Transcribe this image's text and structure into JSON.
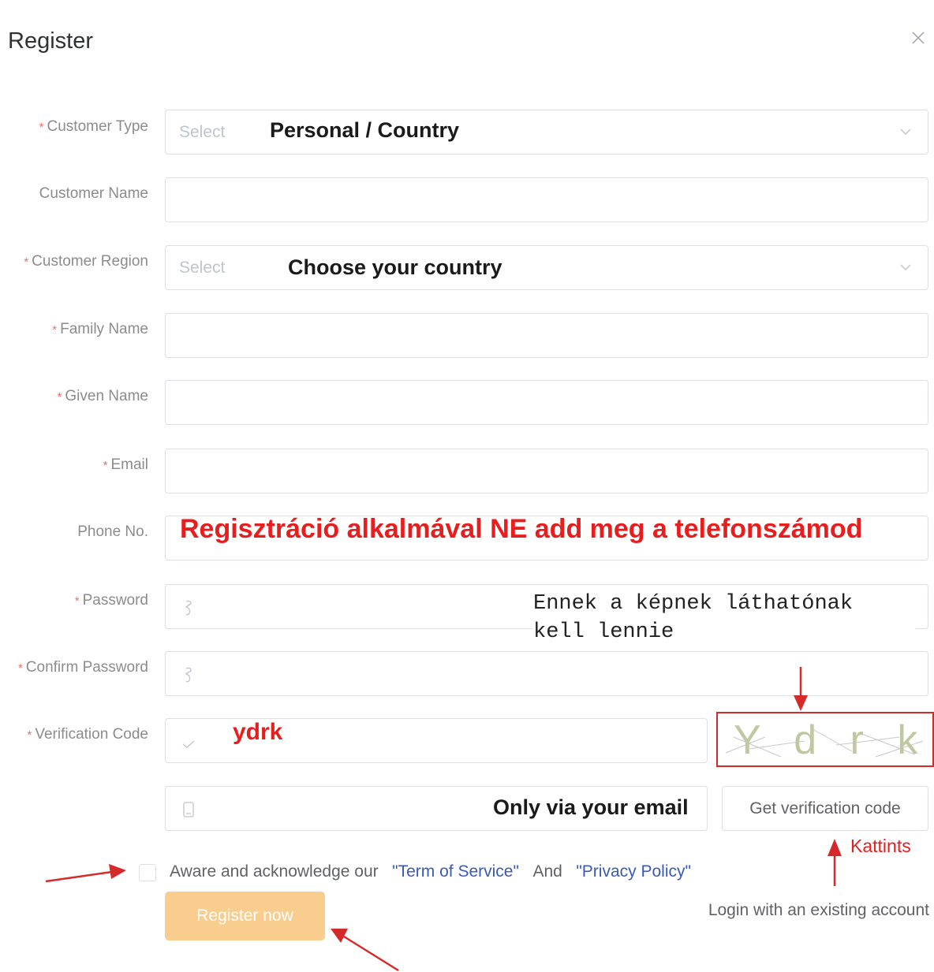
{
  "dialog": {
    "title": "Register"
  },
  "form": {
    "customer_type": {
      "label": "Customer Type",
      "placeholder": "Select"
    },
    "customer_name": {
      "label": "Customer Name"
    },
    "customer_region": {
      "label": "Customer Region",
      "placeholder": "Select"
    },
    "family_name": {
      "label": "Family Name"
    },
    "given_name": {
      "label": "Given Name"
    },
    "email": {
      "label": "Email"
    },
    "phone": {
      "label": "Phone No."
    },
    "password": {
      "label": "Password"
    },
    "confirm_password": {
      "label": "Confirm Password"
    },
    "verification_code": {
      "label": "Verification Code",
      "captcha_text": "Y d r k"
    },
    "email_code": {
      "button": "Get verification code"
    },
    "required_mark": "*"
  },
  "agreement": {
    "prefix": "Aware and acknowledge our",
    "terms": "\"Term of Service\"",
    "and": "And",
    "privacy": "\"Privacy Policy\""
  },
  "actions": {
    "register": "Register now",
    "login": "Login with an existing account"
  },
  "annotations": {
    "customer_type": "Personal / Country",
    "customer_region": "Choose your country",
    "phone_warning": "Regisztráció alkalmával NE add meg a telefonszámod",
    "captcha_note": "Ennek a képnek láthatónak kell lennie",
    "code_value": "ydrk",
    "email_note": "Only via your email",
    "click_note": "Kattints"
  },
  "colors": {
    "accent_button": "#f9cd8e",
    "link": "#3a5ab5",
    "required": "#f56c6c",
    "annotation": "#e81e1e"
  }
}
